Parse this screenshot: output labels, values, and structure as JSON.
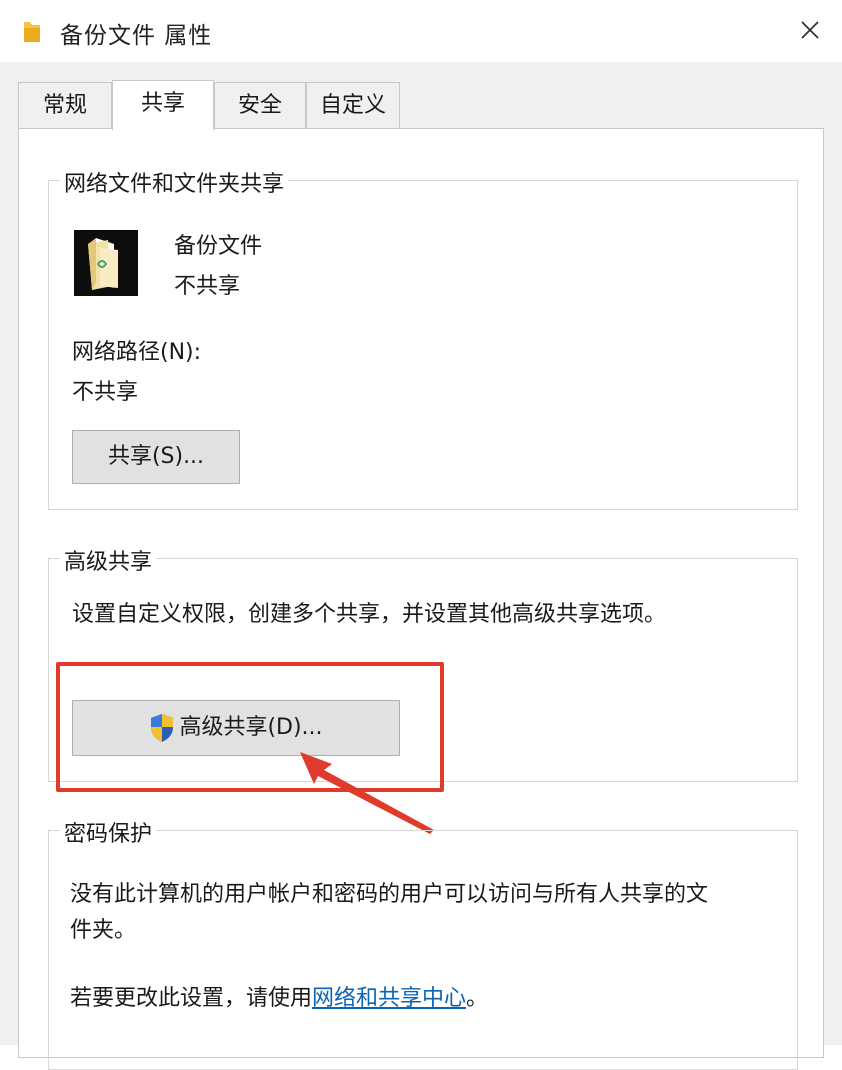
{
  "window": {
    "title": "备份文件 属性",
    "icon": "folder-icon",
    "close_icon": "close-icon"
  },
  "tabs": [
    {
      "label": "常规",
      "active": false
    },
    {
      "label": "共享",
      "active": true
    },
    {
      "label": "安全",
      "active": false
    },
    {
      "label": "自定义",
      "active": false
    }
  ],
  "network_sharing": {
    "group_title": "网络文件和文件夹共享",
    "folder_name": "备份文件",
    "share_status": "不共享",
    "path_label": "网络路径(N):",
    "path_value": "不共享",
    "share_button": "共享(S)..."
  },
  "advanced_sharing": {
    "group_title": "高级共享",
    "description": "设置自定义权限，创建多个共享，并设置其他高级共享选项。",
    "button_icon": "uac-shield-icon",
    "button_label": "高级共享(D)..."
  },
  "password_protection": {
    "group_title": "密码保护",
    "description_line1": "没有此计算机的用户帐户和密码的用户可以访问与所有人共享的文",
    "description_line2": "件夹。",
    "change_text": "若要更改此设置，请使用",
    "link_text": "网络和共享中心",
    "change_suffix": "。"
  },
  "annotation": {
    "highlight_color": "#e03a2c"
  }
}
